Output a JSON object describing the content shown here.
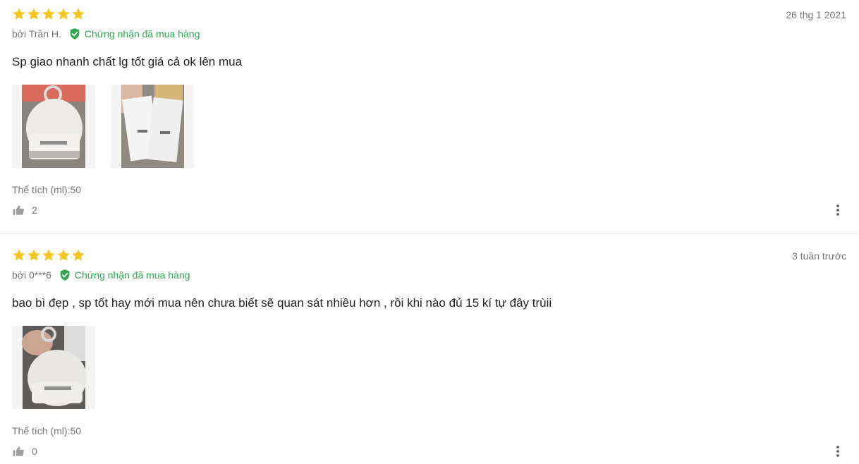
{
  "reviews": [
    {
      "rating": 5,
      "date": "26 thg 1 2021",
      "author": "bởi Trần H.",
      "verified_label": "Chứng nhận đã mua hàng",
      "content": "Sp giao nhanh chất lg tốt giá cả ok lên mua",
      "images": [
        "photo-cream-jar",
        "photo-sample-packets"
      ],
      "variant": "Thể tích (ml):50",
      "likes": "2"
    },
    {
      "rating": 5,
      "date": "3 tuần trước",
      "author": "bởi 0***6",
      "verified_label": "Chứng nhận đã mua hàng",
      "content": "bao bì đẹp , sp tốt hay mới mua nên chưa biết sẽ quan sát nhiều hơn , rồi khi nào đủ 15 kí tự đây trùii",
      "images": [
        "photo-cream-jar-hand"
      ],
      "variant": "Thể tích (ml):50",
      "likes": "0"
    }
  ],
  "colors": {
    "star": "#f8c51c",
    "verified": "#2fa84f",
    "muted_text": "#757575",
    "divider": "#e8e8e8"
  },
  "icons": [
    "star-icon",
    "verified-shield-icon",
    "thumbs-up-icon",
    "more-vertical-icon"
  ]
}
